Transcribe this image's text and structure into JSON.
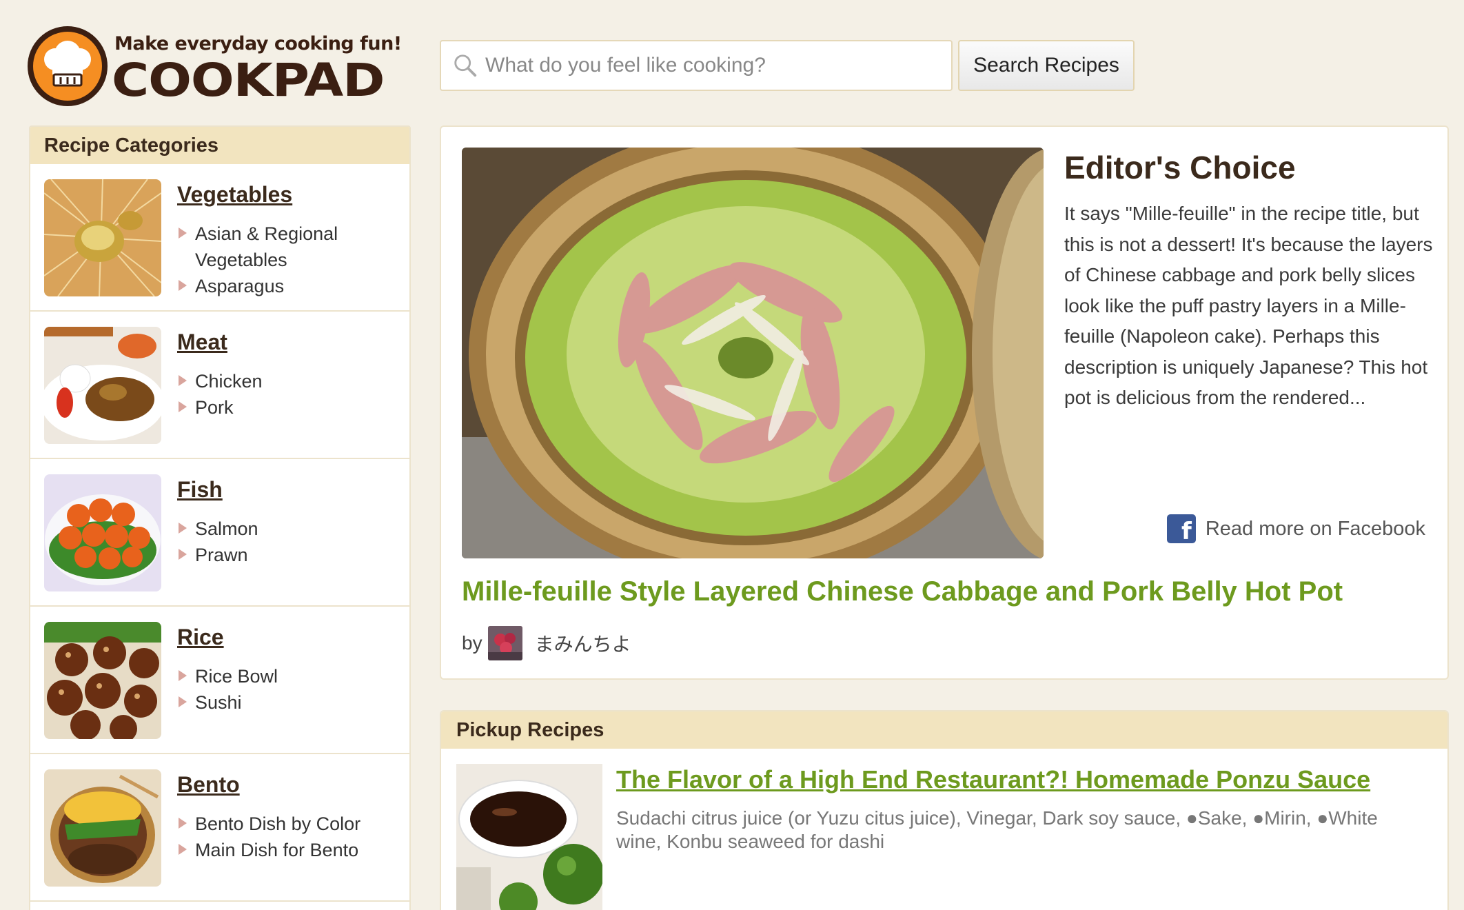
{
  "header": {
    "tagline": "Make everyday cooking fun!",
    "brand": "COOKPAD",
    "search": {
      "placeholder": "What do you feel like cooking?",
      "button_label": "Search Recipes"
    }
  },
  "sidebar": {
    "title": "Recipe Categories",
    "categories": [
      {
        "name": "Vegetables",
        "links": [
          "Asian & Regional Vegetables",
          "Asparagus"
        ]
      },
      {
        "name": "Meat",
        "links": [
          "Chicken",
          "Pork"
        ]
      },
      {
        "name": "Fish",
        "links": [
          "Salmon",
          "Prawn"
        ]
      },
      {
        "name": "Rice",
        "links": [
          "Rice Bowl",
          "Sushi"
        ]
      },
      {
        "name": "Bento",
        "links": [
          "Bento Dish by Color",
          "Main Dish for Bento"
        ]
      }
    ]
  },
  "editors_choice": {
    "heading": "Editor's Choice",
    "description": "It says \"Mille-feuille\" in the recipe title, but this is not a dessert! It's because the layers of Chinese cabbage and pork belly slices look like the puff pastry layers in a Mille-feuille (Napoleon cake). Perhaps this description is uniquely Japanese? This hot pot is delicious from the rendered...",
    "facebook_link": "Read more on Facebook",
    "recipe_title": "Mille-feuille Style Layered Chinese Cabbage and Pork Belly Hot Pot",
    "by_label": "by",
    "author": "まみんちよ"
  },
  "pickup": {
    "title": "Pickup Recipes",
    "recipe_title": "The Flavor of a High End Restaurant?! Homemade Ponzu Sauce",
    "ingredients": "Sudachi citrus juice (or Yuzu citus juice), Vinegar, Dark soy sauce, ●Sake, ●Mirin, ●White wine, Konbu seaweed for dashi"
  },
  "colors": {
    "page_background": "#f4f0e6",
    "section_header": "#f2e4bf",
    "recipe_link_green": "#6d9a1e",
    "logo_orange": "#f58e22",
    "logo_brown": "#3b1f12",
    "facebook_blue": "#3b5998"
  }
}
